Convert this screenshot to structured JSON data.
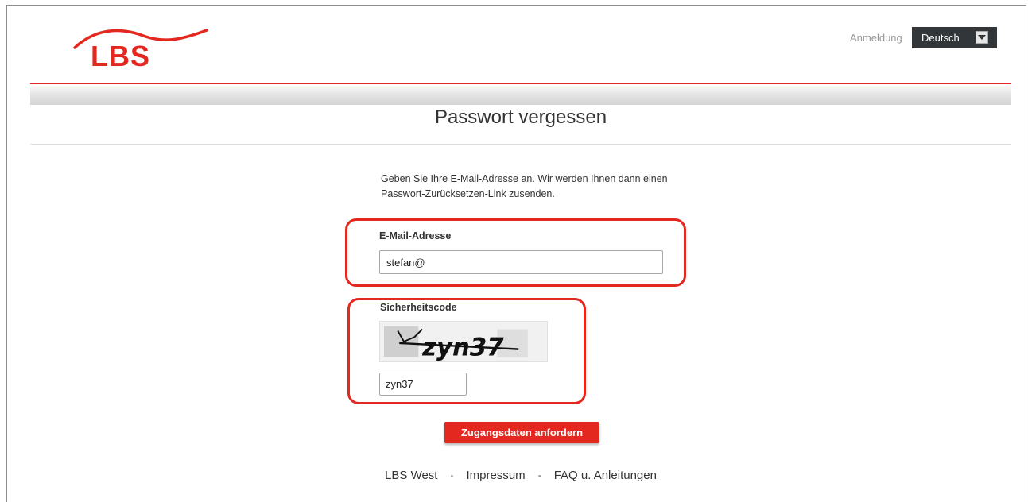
{
  "header": {
    "logo_text": "LBS",
    "login_link": "Anmeldung",
    "language": {
      "selected": "Deutsch"
    }
  },
  "page": {
    "title": "Passwort vergessen",
    "intro": "Geben Sie Ihre E-Mail-Adresse an. Wir werden Ihnen dann einen Passwort-Zurücksetzen-Link zusenden."
  },
  "form": {
    "email": {
      "label": "E-Mail-Adresse",
      "value": "stefan@"
    },
    "captcha": {
      "label": "Sicherheitscode",
      "image_text": "zyn37",
      "value": "zyn37"
    },
    "submit_label": "Zugangsdaten anfordern"
  },
  "footer": {
    "links": [
      "LBS West",
      "Impressum",
      "FAQ u. Anleitungen"
    ],
    "separator": "-"
  },
  "colors": {
    "brand_red": "#e3281f",
    "dark_select": "#333638"
  }
}
